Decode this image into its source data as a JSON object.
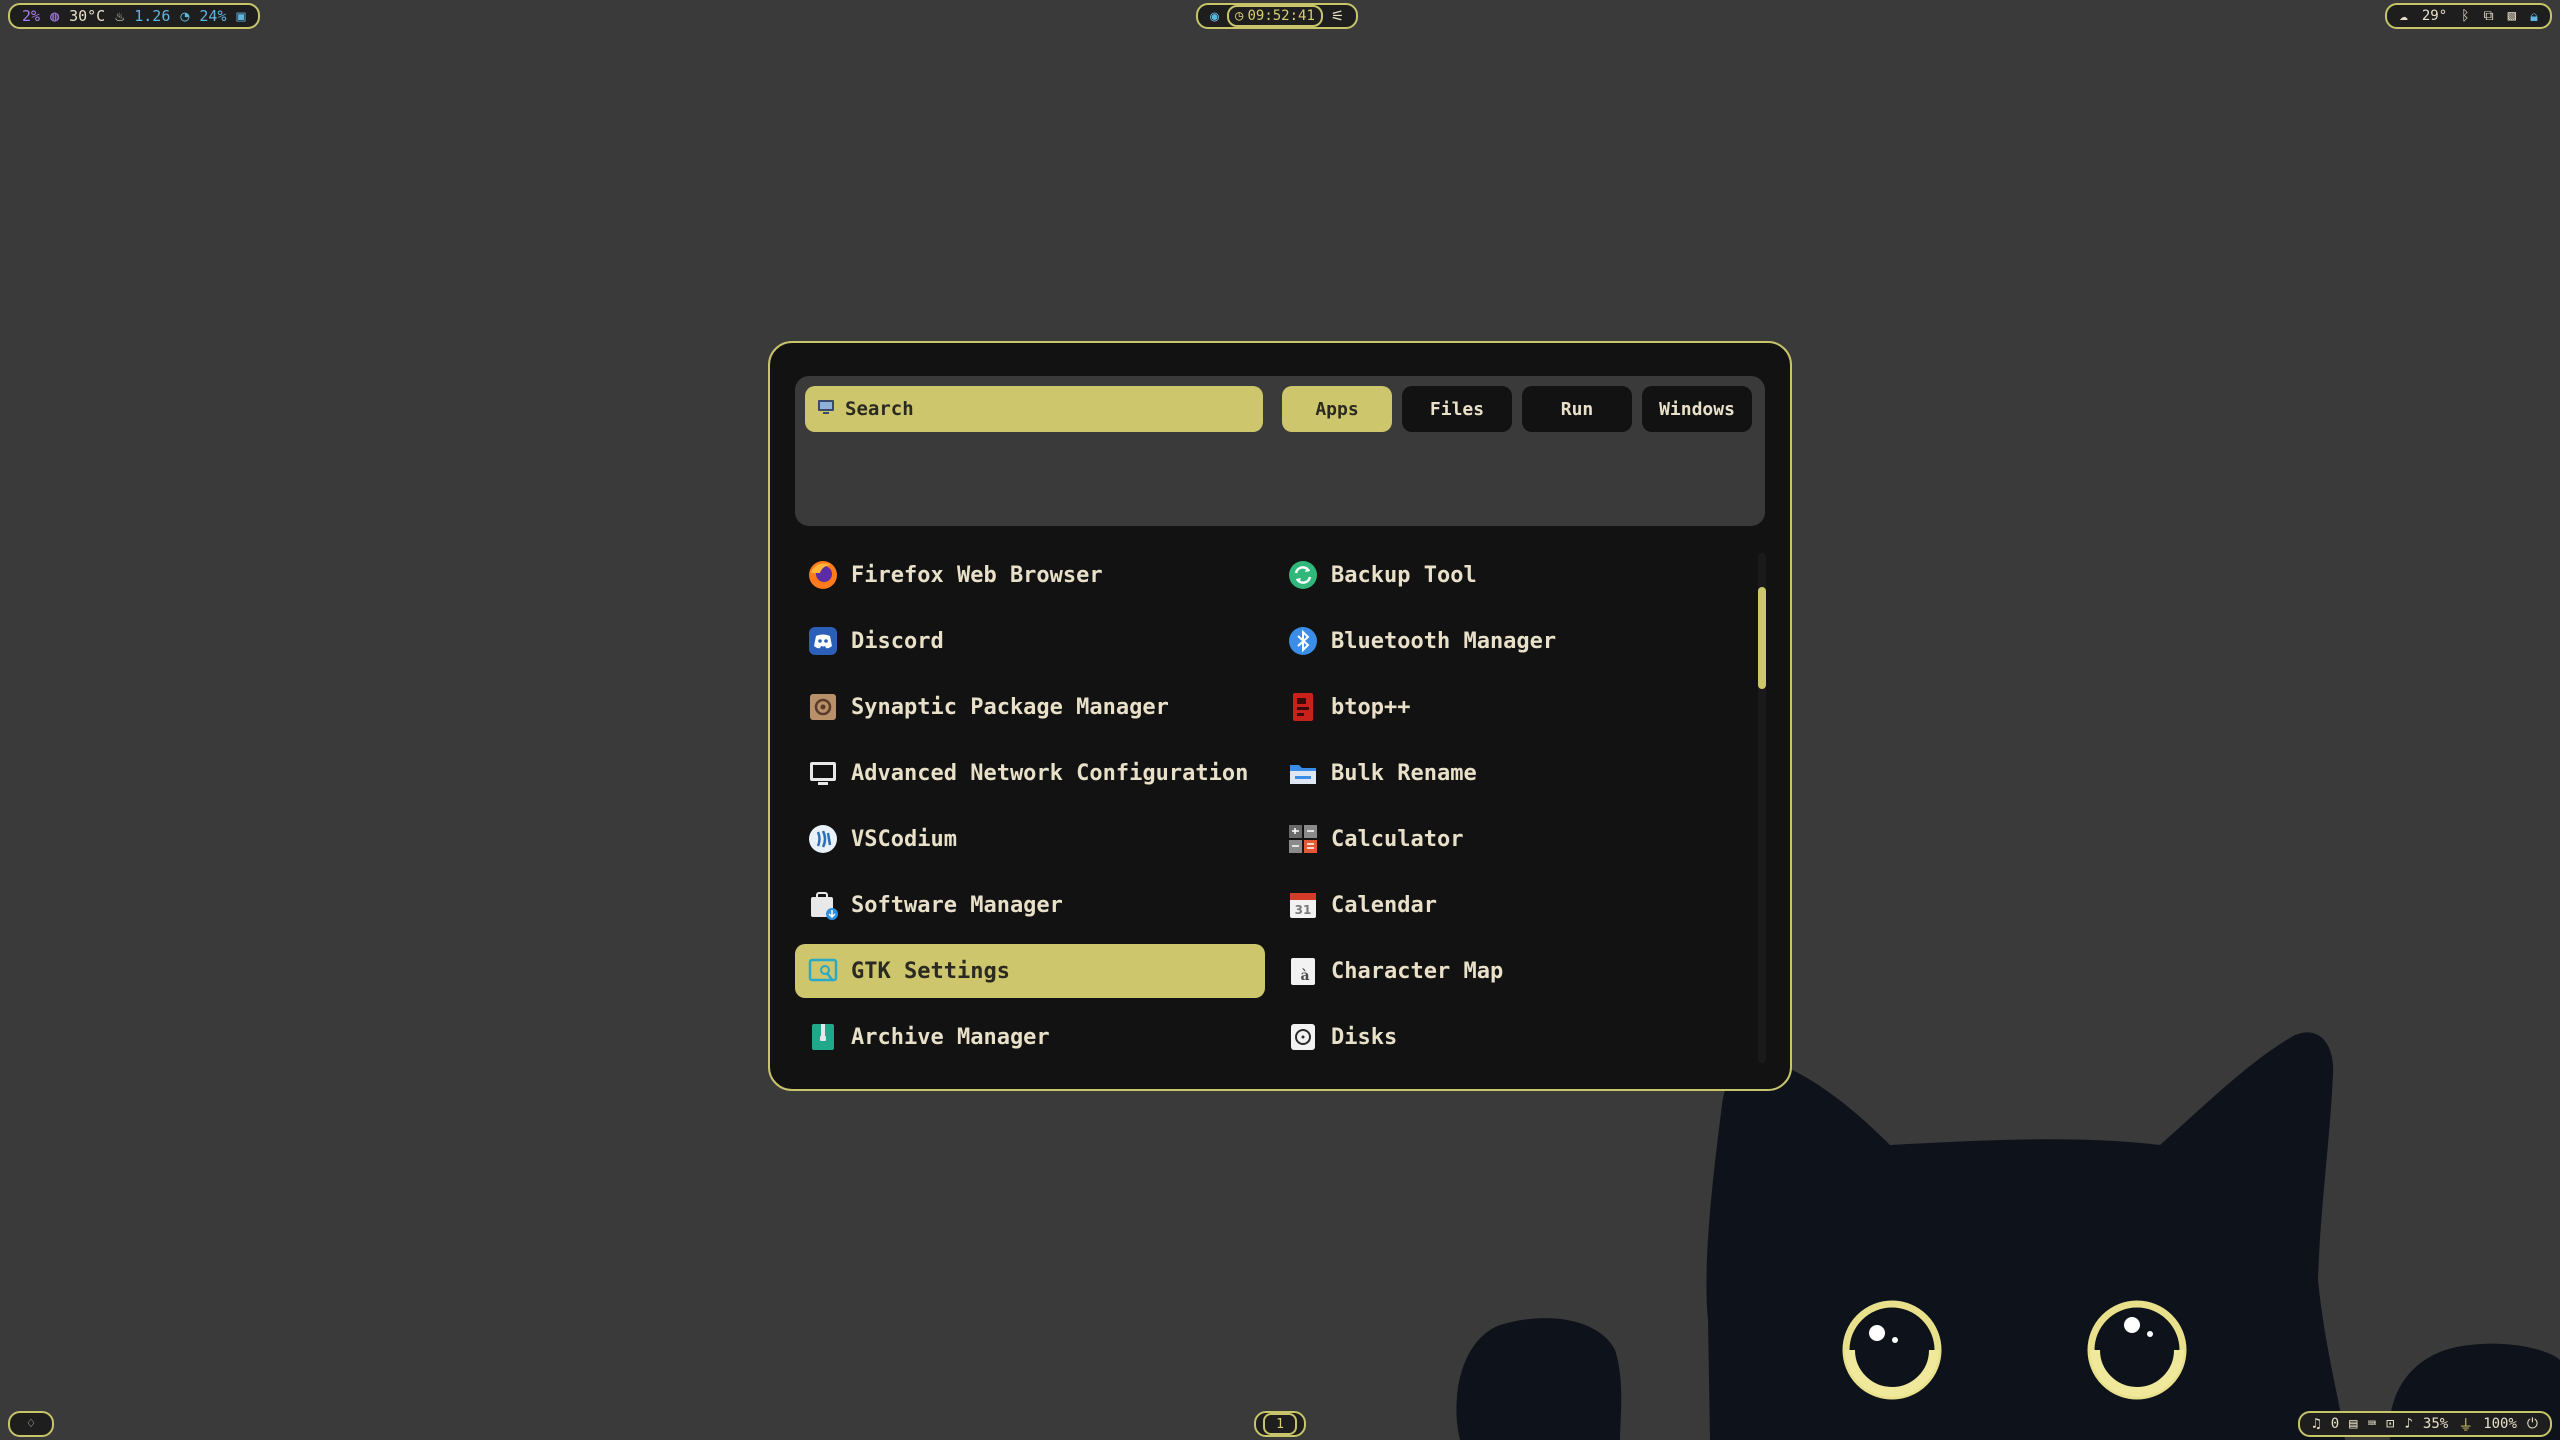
{
  "colors": {
    "accent": "#cdc66d",
    "desktop": "#3a3a3a",
    "panel": "#121212",
    "text": "#e8e0c8"
  },
  "top_bar": {
    "left": {
      "cpu": "2%",
      "temp": "30°C",
      "load": "1.26",
      "memory": "24%"
    },
    "center": {
      "clock": "09:52:41"
    },
    "right": {
      "weather": "29°"
    }
  },
  "bottom_bar": {
    "workspace": "1",
    "notifications": "0",
    "volume": "35%",
    "mic": "100%"
  },
  "launcher": {
    "search_placeholder": "Search",
    "modes": [
      {
        "label": "Apps",
        "active": true
      },
      {
        "label": "Files",
        "active": false
      },
      {
        "label": "Run",
        "active": false
      },
      {
        "label": "Windows",
        "active": false
      }
    ],
    "apps_left": [
      {
        "label": "Firefox Web Browser",
        "icon": "firefox-icon"
      },
      {
        "label": "Discord",
        "icon": "discord-icon"
      },
      {
        "label": "Synaptic Package Manager",
        "icon": "synaptic-icon"
      },
      {
        "label": "Advanced Network Configuration",
        "icon": "network-icon"
      },
      {
        "label": "VSCodium",
        "icon": "vscodium-icon"
      },
      {
        "label": "Software Manager",
        "icon": "software-manager-icon"
      },
      {
        "label": "GTK Settings",
        "icon": "gtk-settings-icon",
        "selected": true
      },
      {
        "label": "Archive Manager",
        "icon": "archive-icon"
      }
    ],
    "apps_right": [
      {
        "label": "Backup Tool",
        "icon": "backup-icon"
      },
      {
        "label": "Bluetooth Manager",
        "icon": "bluetooth-icon"
      },
      {
        "label": "btop++",
        "icon": "btop-icon"
      },
      {
        "label": "Bulk Rename",
        "icon": "bulk-rename-icon"
      },
      {
        "label": "Calculator",
        "icon": "calculator-icon"
      },
      {
        "label": "Calendar",
        "icon": "calendar-icon",
        "icon_text": "31"
      },
      {
        "label": "Character Map",
        "icon": "character-map-icon",
        "icon_text": "à"
      },
      {
        "label": "Disks",
        "icon": "disks-icon"
      }
    ]
  }
}
